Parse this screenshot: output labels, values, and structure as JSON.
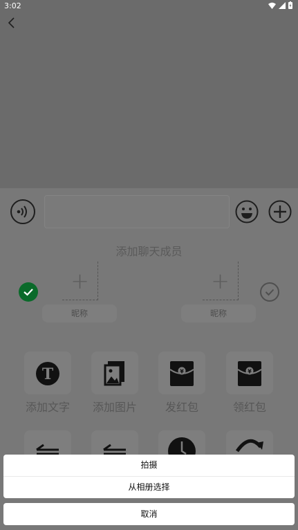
{
  "status_bar": {
    "time": "3:02"
  },
  "composer": {
    "members_title": "添加聊天成员",
    "left_member": {
      "nickname": "昵称"
    },
    "right_member": {
      "nickname": "昵称"
    }
  },
  "tools": [
    {
      "label": "添加文字",
      "icon": "text-t-icon"
    },
    {
      "label": "添加图片",
      "icon": "image-icon"
    },
    {
      "label": "发红包",
      "icon": "red-envelope-icon"
    },
    {
      "label": "领红包",
      "icon": "red-envelope-icon"
    }
  ],
  "tools_row2": [
    {
      "icon": "transfer-icon"
    },
    {
      "icon": "transfer-icon"
    },
    {
      "icon": "clock-icon"
    },
    {
      "icon": "refresh-icon"
    }
  ],
  "action_sheet": {
    "options": [
      "拍摄",
      "从相册选择"
    ],
    "cancel": "取消"
  }
}
